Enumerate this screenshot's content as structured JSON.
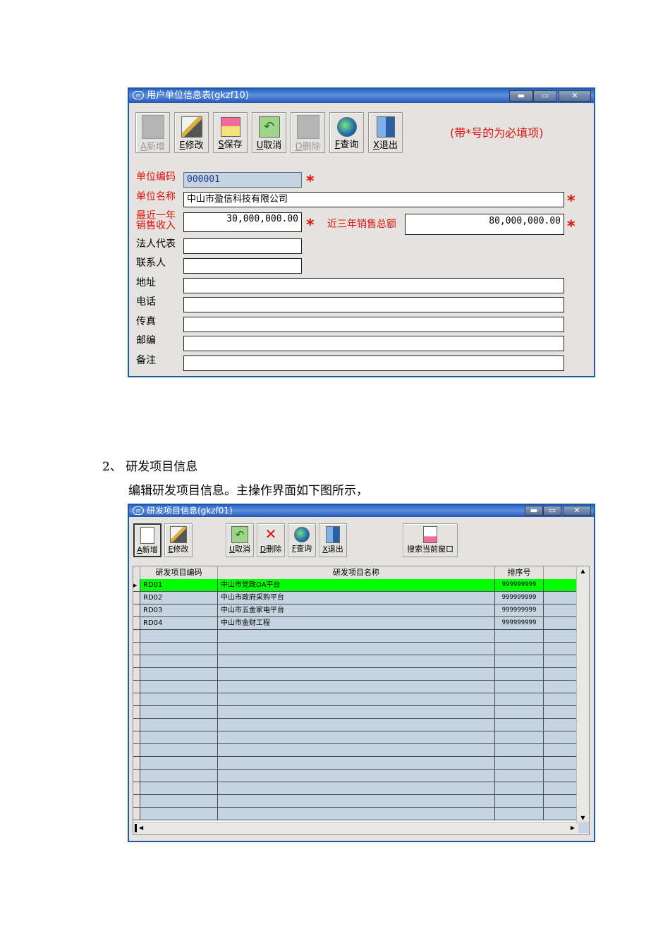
{
  "window1": {
    "title": "用户单位信息表(gkzf10)",
    "title_icon": "IT",
    "controls": {
      "minimize": "▬",
      "maximize": "▭",
      "close": "✕"
    },
    "toolbar": [
      {
        "hotkey": "A",
        "label": "新增",
        "icon": "new-doc-icon",
        "enabled": false
      },
      {
        "hotkey": "E",
        "label": "修改",
        "icon": "edit-pencil-icon",
        "enabled": true
      },
      {
        "hotkey": "S",
        "label": "保存",
        "icon": "floppy-disk-icon",
        "enabled": true
      },
      {
        "hotkey": "U",
        "label": "取消",
        "icon": "undo-arrow-icon",
        "enabled": true
      },
      {
        "hotkey": "D",
        "label": "删除",
        "icon": "delete-icon",
        "enabled": false
      },
      {
        "hotkey": "F",
        "label": "查询",
        "icon": "globe-search-icon",
        "enabled": true
      },
      {
        "hotkey": "X",
        "label": "退出",
        "icon": "exit-door-icon",
        "enabled": true
      }
    ],
    "required_note": "(带*号的为必填项)",
    "required_mark": "*",
    "fields": {
      "unit_code": {
        "label": "单位编码",
        "value": "000001"
      },
      "unit_name": {
        "label": "单位名称",
        "value": "中山市盈信科技有限公司"
      },
      "last_year_sales": {
        "label_line1": "最近一年",
        "label_line2": "销售收入",
        "value": "30,000,000.00"
      },
      "three_year_sales": {
        "label": "近三年销售总额",
        "value": "80,000,000.00"
      },
      "legal_rep": {
        "label": "法人代表",
        "value": ""
      },
      "contact": {
        "label": "联系人",
        "value": ""
      },
      "address": {
        "label": "地址",
        "value": ""
      },
      "phone": {
        "label": "电话",
        "value": ""
      },
      "fax": {
        "label": "传真",
        "value": ""
      },
      "postcode": {
        "label": "邮编",
        "value": ""
      },
      "remark": {
        "label": "备注",
        "value": ""
      }
    },
    "colors": {
      "required": "#e0100c",
      "code_field_bg": "#c6d4e2"
    }
  },
  "doc": {
    "section_heading": "2、 研发项目信息",
    "intro": "编辑研发项目信息。主操作界面如下图所示，"
  },
  "window2": {
    "title": "研发项目信息(gkzf01)",
    "title_icon": "IT",
    "controls": {
      "minimize": "▬",
      "maximize": "▭",
      "close": "✕"
    },
    "toolbar": [
      {
        "hotkey": "A",
        "label": "新增",
        "icon": "new-doc-icon",
        "enabled": true
      },
      {
        "hotkey": "E",
        "label": "修改",
        "icon": "edit-pencil-icon",
        "enabled": true
      },
      {
        "hotkey": "U",
        "label": "取消",
        "icon": "undo-arrow-icon",
        "enabled": true
      },
      {
        "hotkey": "D",
        "label": "删除",
        "icon": "delete-x-icon",
        "enabled": true
      },
      {
        "hotkey": "F",
        "label": "查询",
        "icon": "globe-search-icon",
        "enabled": true
      },
      {
        "hotkey": "X",
        "label": "退出",
        "icon": "exit-door-icon",
        "enabled": true
      }
    ],
    "search_button": {
      "label": "搜索当前窗口",
      "icon": "search-window-icon"
    },
    "grid": {
      "columns": [
        "研发项目编码",
        "研发项目名称",
        "排序号"
      ],
      "rows": [
        {
          "code": "RD01",
          "name": "中山市党政OA平台",
          "order": "999999999",
          "selected": true
        },
        {
          "code": "RD02",
          "name": "中山市政府采购平台",
          "order": "999999999",
          "selected": false
        },
        {
          "code": "RD03",
          "name": "中山市五金家电平台",
          "order": "999999999",
          "selected": false
        },
        {
          "code": "RD04",
          "name": "中山市金财工程",
          "order": "999999999",
          "selected": false
        }
      ],
      "selected_color": "#00ff00",
      "row_color": "#c6d4e2"
    }
  }
}
